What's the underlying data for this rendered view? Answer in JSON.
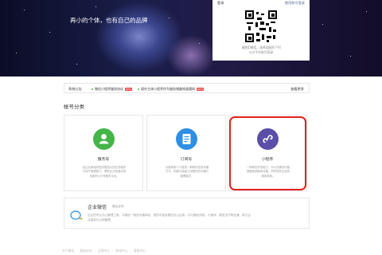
{
  "hero": {
    "slogan": "再小的个体，也有自己的品牌"
  },
  "login": {
    "title": "登录",
    "account_login_link": "使用帐号登录",
    "qr_tip_line1": "请使用微信，选择适配的下列",
    "qr_tip_line2": "公众平台账号登录"
  },
  "notice": {
    "title": "系统公告",
    "items": [
      {
        "text": "微信小程序服务协议",
        "is_new": true
      },
      {
        "text": "境外主体小程序作为服务储备知道通知",
        "is_new": true
      }
    ],
    "new_label": "NEW",
    "more_label": "查看更多"
  },
  "section": {
    "title": "帐号分类"
  },
  "cards": [
    {
      "name": "服务号",
      "desc_line1": "给企业和组织提供更强大的业务服务",
      "desc_line2": "与用户管理能力，帮助企业快速实现",
      "desc_line3": "全新的公众号服务平台。",
      "icon": "service-account-icon",
      "color": "#44b549"
    },
    {
      "name": "订阅号",
      "desc_line1": "为媒体和个人提供一种新的信息传播",
      "desc_line2": "方式，构建与读者之间更好的沟通与",
      "desc_line3": "管理模式。",
      "icon": "subscription-account-icon",
      "color": "#2e8fe4"
    },
    {
      "name": "小程序",
      "desc_line1": "一种新的开放能力，可以在微信内被",
      "desc_line2": "便捷地获取和传播，同时具有出色的",
      "desc_line3": "使用体验。",
      "icon": "mini-program-icon",
      "color": "#5a4ea7"
    }
  ],
  "wework": {
    "name": "企业微信",
    "tag": "原企业号",
    "desc_line1": "企业的专业办公管理工具。与微信一致的沟通体验，提供丰富免费的办公应用，并与微信消息、小程序、微信支付等互通，助力企",
    "desc_line2": "业高效办公和管理。",
    "icon": "wework-icon"
  },
  "footer": {
    "links": [
      "关于腾讯",
      "服务协议",
      "运营中心",
      "辟谣中心",
      "客服中心"
    ]
  }
}
